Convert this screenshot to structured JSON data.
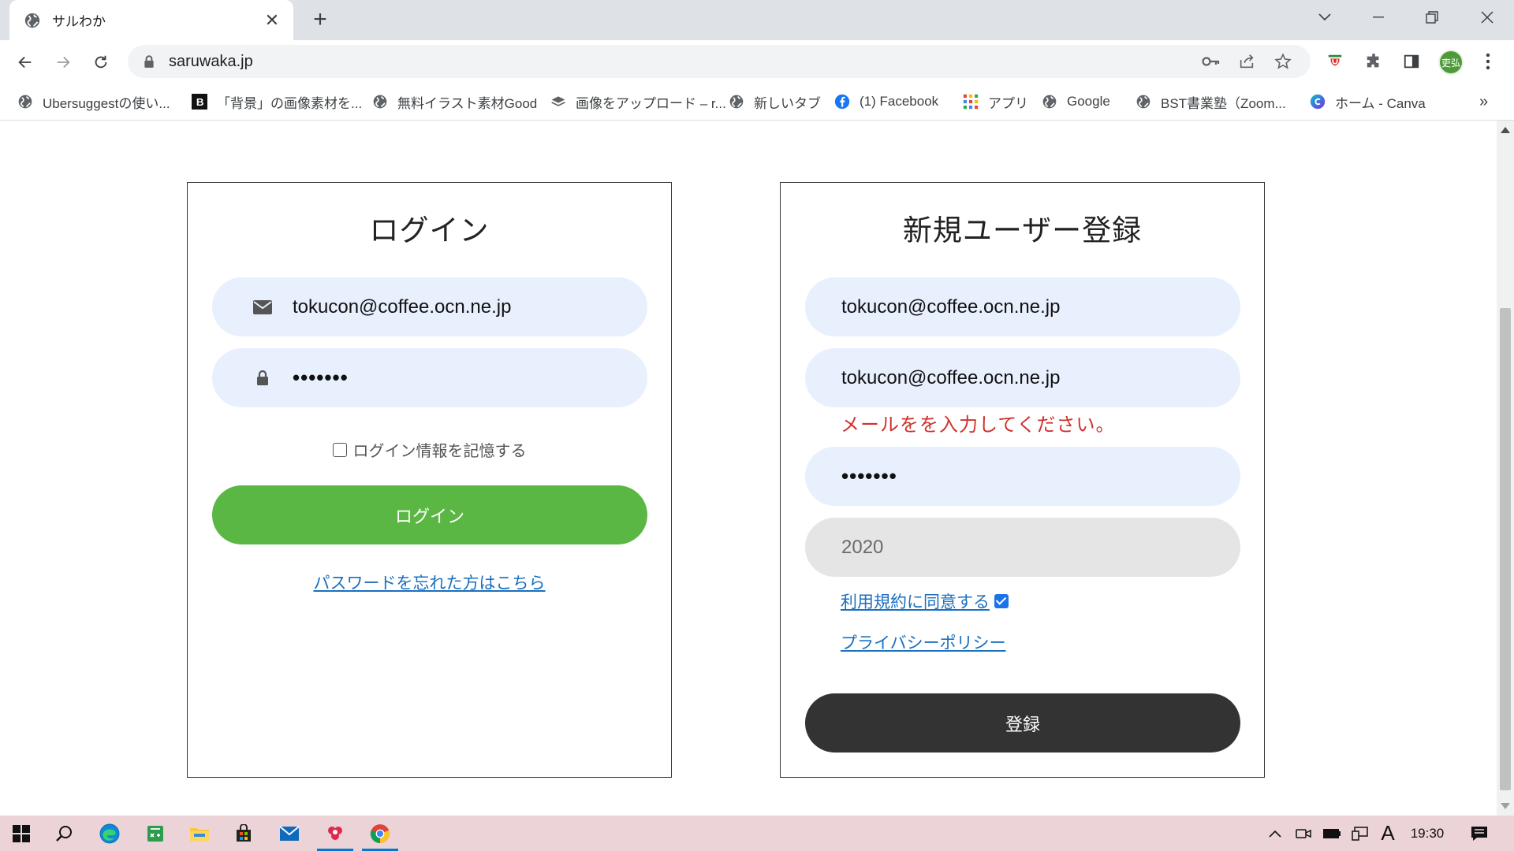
{
  "browser": {
    "tab_title": "サルわか",
    "tab_close": "✕",
    "new_tab": "+",
    "url": "saruwaka.jp",
    "profile_label": "吏弘"
  },
  "bookmarks": [
    {
      "label": "Ubersuggestの使い...",
      "icon": "globe-icon"
    },
    {
      "label": "「背景」の画像素材を...",
      "icon": "b-icon"
    },
    {
      "label": "無料イラスト素材Good",
      "icon": "globe-icon"
    },
    {
      "label": "画像をアップロード – r...",
      "icon": "layers-icon"
    },
    {
      "label": "新しいタブ",
      "icon": "globe-icon"
    },
    {
      "label": "(1) Facebook",
      "icon": "facebook-icon"
    },
    {
      "label": "アプリ",
      "icon": "apps-grid-icon"
    },
    {
      "label": "Google",
      "icon": "globe-icon"
    },
    {
      "label": "BST書業塾（Zoom...",
      "icon": "globe-icon"
    },
    {
      "label": "ホーム - Canva",
      "icon": "canva-icon"
    }
  ],
  "bookmarks_more": "»",
  "login": {
    "title": "ログイン",
    "email_value": "tokucon@coffee.ocn.ne.jp",
    "password_value": "•••••••",
    "remember_label": "ログイン情報を記憶する",
    "submit_label": "ログイン",
    "forgot_link": "パスワードを忘れた方はこちら"
  },
  "register": {
    "title": "新規ユーザー登録",
    "email_value": "tokucon@coffee.ocn.ne.jp",
    "email_confirm_value": "tokucon@coffee.ocn.ne.jp",
    "error_message": "メールをを入力してください。",
    "password_value": "•••••••",
    "year_value": "2020",
    "terms_link": "利用規約に同意する",
    "terms_checked": true,
    "privacy_link": "プライバシーポリシー",
    "submit_label": "登録"
  },
  "taskbar": {
    "clock": "19:30",
    "ime": "A",
    "tray_chevron": "^"
  },
  "colors": {
    "accent_green": "#5bb744",
    "dark_button": "#333333",
    "input_bg": "#e8f0fe",
    "error_red": "#d0312d",
    "link_blue": "#1a6fc0"
  }
}
